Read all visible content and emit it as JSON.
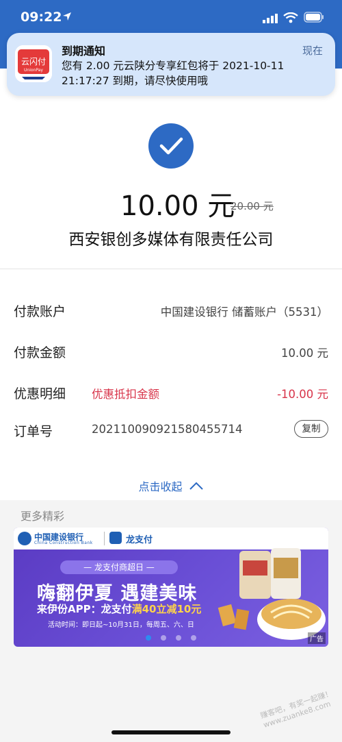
{
  "status": {
    "time": "09:22"
  },
  "notification": {
    "app_name": "云闪付",
    "app_sub": "UnionPay",
    "title": "到期通知",
    "time": "现在",
    "body": "您有 2.00 元云陕分专享红包将于 2021-10-11 21:17:27 到期，请尽快使用哦"
  },
  "payment": {
    "amount": "10.00 元",
    "original_amount": "20.00 元",
    "merchant": "西安银创多媒体有限责任公司"
  },
  "details": {
    "account_label": "付款账户",
    "account_value": "中国建设银行 储蓄账户（5531）",
    "amount_label": "付款金额",
    "amount_value": "10.00 元",
    "discount_label": "优惠明细",
    "discount_desc": "优惠抵扣金额",
    "discount_value": "-10.00 元",
    "order_label": "订单号",
    "order_value": "20211009092158045571​4",
    "copy_label": "复制"
  },
  "collapse_label": "点击收起",
  "more": {
    "title": "更多精彩",
    "ad": {
      "bank_name": "中国建设银行",
      "bank_sub": "China Construction Bank",
      "pay_name": "龙支付",
      "pill": "— 龙支付商超日 —",
      "headline": "嗨翻伊夏 遇建美味",
      "sub_prefix": "来伊份APP：龙支付",
      "sub_highlight": "满40立减10元",
      "date": "活动时间：即日起~10月31日，每周五、六、日",
      "tag": "广告",
      "dots": 4,
      "active_dot": 0
    }
  },
  "watermark": "赚客吧，有奖一起赚！ www.zuanke8.com",
  "colors": {
    "brand_blue": "#2d6ac4",
    "discount_red": "#d8344a",
    "ad_purple": "#5a3ac2"
  }
}
